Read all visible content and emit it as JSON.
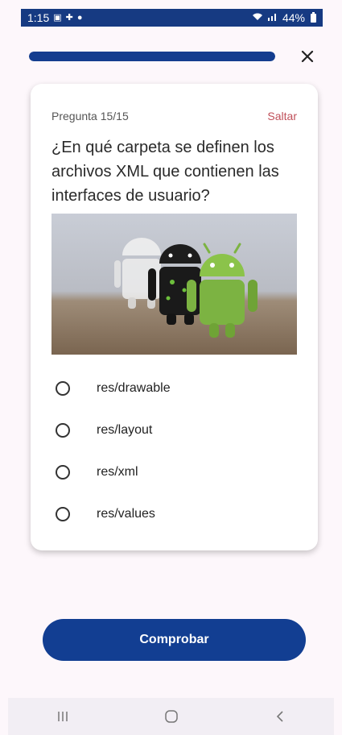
{
  "status_bar": {
    "time": "1:15",
    "battery": "44%",
    "icons": [
      "gallery-icon",
      "game-icon",
      "chat-icon",
      "wifi-icon",
      "signal-icon",
      "battery-icon"
    ]
  },
  "quiz": {
    "progress": 1.0,
    "question_number": "Pregunta 15/15",
    "skip_label": "Saltar",
    "question": "¿En qué carpeta se definen los archivos XML que contienen las interfaces de usuario?",
    "options": [
      {
        "label": "res/drawable"
      },
      {
        "label": "res/layout"
      },
      {
        "label": "res/xml"
      },
      {
        "label": "res/values"
      }
    ],
    "check_label": "Comprobar"
  },
  "colors": {
    "primary": "#123e92",
    "skip": "#c0505a",
    "android_green": "#8bc34a"
  },
  "nav": {
    "icons": [
      "recents-icon",
      "home-icon",
      "back-icon"
    ]
  }
}
